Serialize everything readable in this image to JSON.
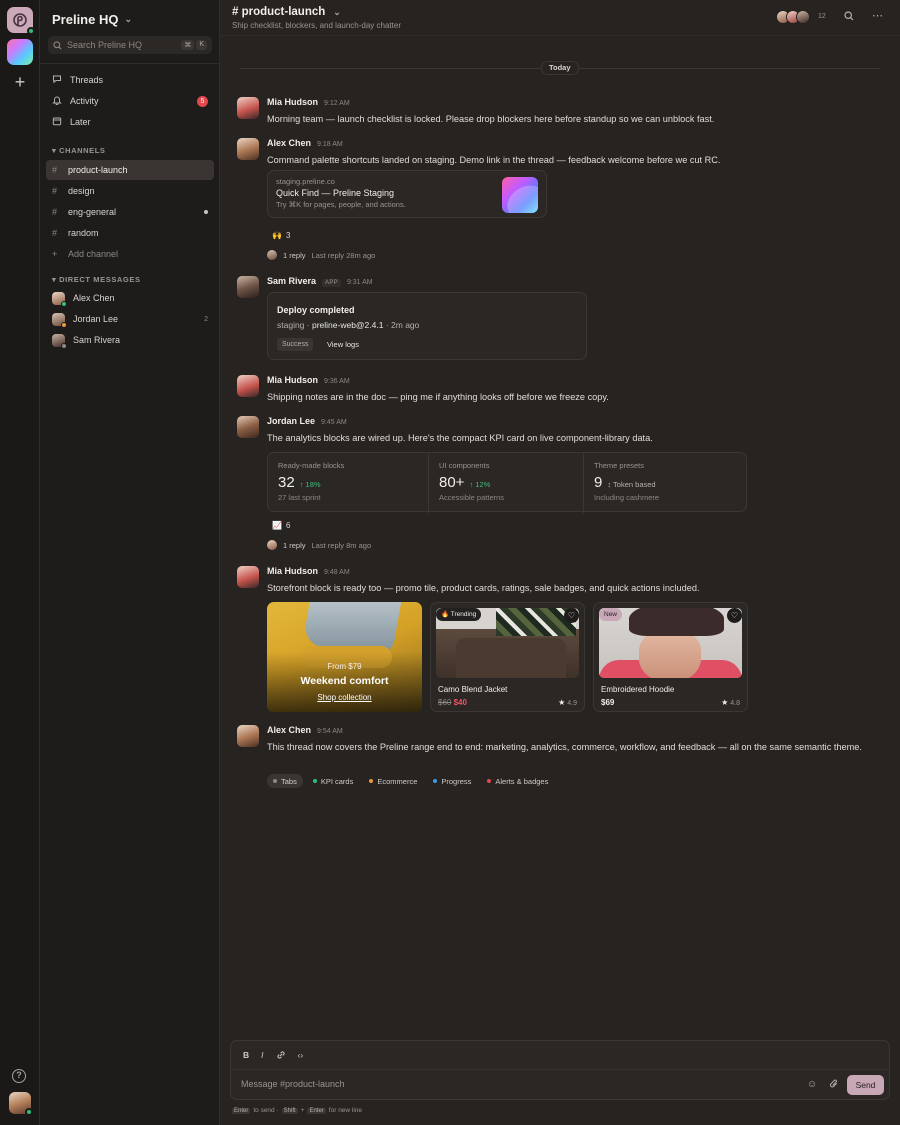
{
  "workspace": {
    "name": "Preline HQ"
  },
  "search": {
    "placeholder": "Search Preline HQ",
    "shortcut": [
      "⌘",
      "K"
    ]
  },
  "nav": {
    "threads": "Threads",
    "activity": "Activity",
    "activity_badge": "5",
    "later": "Later"
  },
  "channels": {
    "heading": "CHANNELS",
    "items": [
      "product-launch",
      "design",
      "eng-general",
      "random"
    ],
    "add": "Add channel"
  },
  "dms": {
    "heading": "DIRECT MESSAGES",
    "items": [
      {
        "name": "Alex Chen",
        "count": ""
      },
      {
        "name": "Jordan Lee",
        "count": "2"
      },
      {
        "name": "Sam Rivera",
        "count": ""
      }
    ]
  },
  "header": {
    "title": "# product-launch",
    "subtitle": "Ship checklist, blockers, and launch-day chatter",
    "member_count": "12"
  },
  "day_divider": "Today",
  "messages": [
    {
      "author": "Mia Hudson",
      "time": "9:12 AM",
      "text": "Morning team — launch checklist is locked. Please drop blockers here before standup so we can unblock fast."
    },
    {
      "author": "Alex Chen",
      "time": "9:18 AM",
      "text": "Command palette shortcuts landed on staging. Demo link in the thread — feedback welcome before we cut RC.",
      "link": {
        "host": "staging.preline.co",
        "title": "Quick Find — Preline Staging",
        "desc": "Try ⌘K for pages, people, and actions."
      },
      "reaction": {
        "emoji": "🙌",
        "count": "3"
      },
      "reply": {
        "count": "1 reply",
        "last": "Last reply 28m ago"
      }
    },
    {
      "author": "Sam Rivera",
      "tag": "APP",
      "time": "9:31 AM",
      "deploy": {
        "title": "Deploy completed",
        "env": "staging",
        "pkg": "preline-web@2.4.1",
        "ago": "2m ago",
        "status": "Success",
        "logs": "View logs"
      }
    },
    {
      "author": "Mia Hudson",
      "time": "9:36 AM",
      "text": "Shipping notes are in the doc — ping me if anything looks off before we freeze copy."
    },
    {
      "author": "Jordan Lee",
      "time": "9:45 AM",
      "text": "The analytics blocks are wired up. Here's the compact KPI card on live component-library data.",
      "kpis": [
        {
          "label": "Ready-made blocks",
          "value": "32",
          "delta": "18%",
          "sub": "27 last sprint"
        },
        {
          "label": "UI components",
          "value": "80+",
          "delta": "12%",
          "sub": "Accessible patterns"
        },
        {
          "label": "Theme presets",
          "value": "9",
          "delta": "Token based",
          "sub": "Including cashmere"
        }
      ],
      "reaction": {
        "emoji": "📈",
        "count": "6"
      },
      "reply": {
        "count": "1 reply",
        "last": "Last reply 8m ago"
      }
    },
    {
      "author": "Mia Hudson",
      "time": "9:48 AM",
      "text": "Storefront block is ready too — promo tile, product cards, ratings, sale badges, and quick actions included.",
      "promo": {
        "from": "From $79",
        "title": "Weekend comfort",
        "cta": "Shop collection"
      },
      "products": [
        {
          "tag": "🔥 Trending",
          "name": "Camo Blend Jacket",
          "old": "$60",
          "price": "$40",
          "rating": "4.9"
        },
        {
          "tag": "New",
          "name": "Embroidered Hoodie",
          "old": "",
          "price": "$69",
          "rating": "4.8"
        }
      ]
    },
    {
      "author": "Alex Chen",
      "time": "9:54 AM",
      "text": "This thread now covers the Preline range end to end: marketing, analytics, commerce, workflow, and feedback — all on the same semantic theme.",
      "chips": [
        {
          "label": "Tabs",
          "color": ""
        },
        {
          "label": "KPI cards",
          "color": "#2dbf7a"
        },
        {
          "label": "Ecommerce",
          "color": "#e8973a"
        },
        {
          "label": "Progress",
          "color": "#3b9be6"
        },
        {
          "label": "Alerts & badges",
          "color": "#e2474b"
        }
      ]
    }
  ],
  "composer": {
    "placeholder": "Message #product-launch",
    "send": "Send",
    "format": [
      "B",
      "I"
    ],
    "hint": {
      "enter": "Enter",
      "to_send": "to send ·",
      "shift": "Shift",
      "plus": "+",
      "enter2": "Enter",
      "newline": "for new line"
    }
  },
  "colors": {
    "accent": "#c8a7b7",
    "online": "#2dbf7a",
    "alert": "#e2474b"
  }
}
